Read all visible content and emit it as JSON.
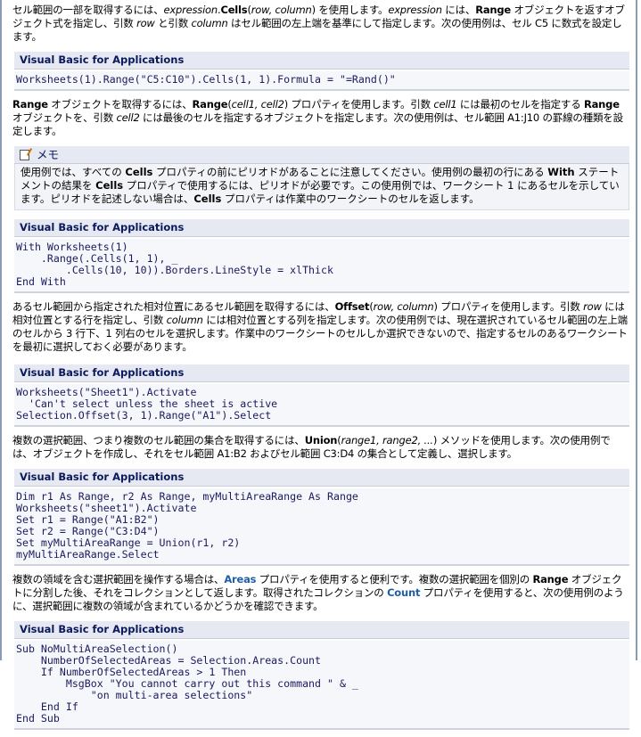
{
  "block_header": "Visual Basic for Applications",
  "memo_title": "メモ",
  "paragraphs": [
    [
      {
        "t": "セル範囲の一部を取得するには、"
      },
      {
        "t": "expression",
        "s": "i"
      },
      {
        "t": "."
      },
      {
        "t": "Cells",
        "s": "b"
      },
      {
        "t": "("
      },
      {
        "t": "row, column",
        "s": "i"
      },
      {
        "t": ") を使用します。"
      },
      {
        "t": "expression",
        "s": "i"
      },
      {
        "t": " には、"
      },
      {
        "t": "Range",
        "s": "b"
      },
      {
        "t": " オブジェクトを返すオブジェクト式を指定し、引数 "
      },
      {
        "t": "row",
        "s": "i"
      },
      {
        "t": " と引数 "
      },
      {
        "t": "column",
        "s": "i"
      },
      {
        "t": " はセル範囲の左上端を基準にして指定します。次の使用例は、セル C5 に数式を設定します。"
      }
    ],
    [
      {
        "t": "Range",
        "s": "b"
      },
      {
        "t": " オブジェクトを取得するには、"
      },
      {
        "t": "Range",
        "s": "b"
      },
      {
        "t": "("
      },
      {
        "t": "cell1, cell2",
        "s": "i"
      },
      {
        "t": ") プロパティを使用します。引数 "
      },
      {
        "t": "cell1",
        "s": "i"
      },
      {
        "t": " には最初のセルを指定する "
      },
      {
        "t": "Range",
        "s": "b"
      },
      {
        "t": " オブジェクトを、引数 "
      },
      {
        "t": "cell2",
        "s": "i"
      },
      {
        "t": " には最後のセルを指定するオブジェクトを指定します。次の使用例は、セル範囲 A1:J10 の罫線の種類を設定します。"
      }
    ],
    [
      {
        "t": "あるセル範囲から指定された相対位置にあるセル範囲を取得するには、"
      },
      {
        "t": "Offset",
        "s": "b"
      },
      {
        "t": "("
      },
      {
        "t": "row, column",
        "s": "i"
      },
      {
        "t": ") プロパティを使用します。引数 "
      },
      {
        "t": "row",
        "s": "i"
      },
      {
        "t": " には相対位置とする行を指定し、引数 "
      },
      {
        "t": "column",
        "s": "i"
      },
      {
        "t": " には相対位置とする列を指定します。次の使用例では、現在選択されているセル範囲の左上端のセルから 3 行下、1 列右のセルを選択します。作業中のワークシートのセルしか選択できないので、指定するセルのあるワークシートを最初に選択しておく必要があります。"
      }
    ],
    [
      {
        "t": "複数の選択範囲、つまり複数のセル範囲の集合を取得するには、"
      },
      {
        "t": "Union",
        "s": "b"
      },
      {
        "t": "("
      },
      {
        "t": "range1, range2, ...",
        "s": "i"
      },
      {
        "t": ") メソッドを使用します。次の使用例では、オブジェクトを作成し、それをセル範囲 A1:B2 およびセル範囲 C3:D4 の集合として定義し、選択します。"
      }
    ],
    [
      {
        "t": "複数の領域を含む選択範囲を操作する場合は、"
      },
      {
        "t": "Areas",
        "s": "link"
      },
      {
        "t": " プロパティを使用すると便利です。複数の選択範囲を個別の "
      },
      {
        "t": "Range",
        "s": "b"
      },
      {
        "t": " オブジェクトに分割した後、それをコレクションとして返します。取得されたコレクションの "
      },
      {
        "t": "Count",
        "s": "link"
      },
      {
        "t": " プロパティを使用すると、次の使用例のように、選択範囲に複数の領域が含まれているかどうかを確認できます。"
      }
    ]
  ],
  "memo": [
    {
      "t": "使用例では、すべての "
    },
    {
      "t": "Cells",
      "s": "b"
    },
    {
      "t": " プロパティの前にピリオドがあることに注意してください。使用例の最初の行にある "
    },
    {
      "t": "With",
      "s": "b"
    },
    {
      "t": " ステートメントの結果を "
    },
    {
      "t": "Cells",
      "s": "b"
    },
    {
      "t": " プロパティで使用するには、ピリオドが必要です。この使用例では、ワークシート 1 にあるセルを示しています。ピリオドを記述しない場合は、"
    },
    {
      "t": "Cells",
      "s": "b"
    },
    {
      "t": " プロパティは作業中のワークシートのセルを返します。"
    }
  ],
  "code": [
    "Worksheets(1).Range(\"C5:C10\").Cells(1, 1).Formula = \"=Rand()\"",
    "With Worksheets(1)\n    .Range(.Cells(1, 1), _\n        .Cells(10, 10)).Borders.LineStyle = xlThick\nEnd With",
    "Worksheets(\"Sheet1\").Activate\n  'Can't select unless the sheet is active\nSelection.Offset(3, 1).Range(\"A1\").Select",
    "Dim r1 As Range, r2 As Range, myMultiAreaRange As Range\nWorksheets(\"sheet1\").Activate\nSet r1 = Range(\"A1:B2\")\nSet r2 = Range(\"C3:D4\")\nSet myMultiAreaRange = Union(r1, r2)\nmyMultiAreaRange.Select",
    "Sub NoMultiAreaSelection()\n    NumberOfSelectedAreas = Selection.Areas.Count\n    If NumberOfSelectedAreas > 1 Then\n        MsgBox \"You cannot carry out this command \" & _\n            \"on multi-area selections\"\n    End If\nEnd Sub"
  ]
}
